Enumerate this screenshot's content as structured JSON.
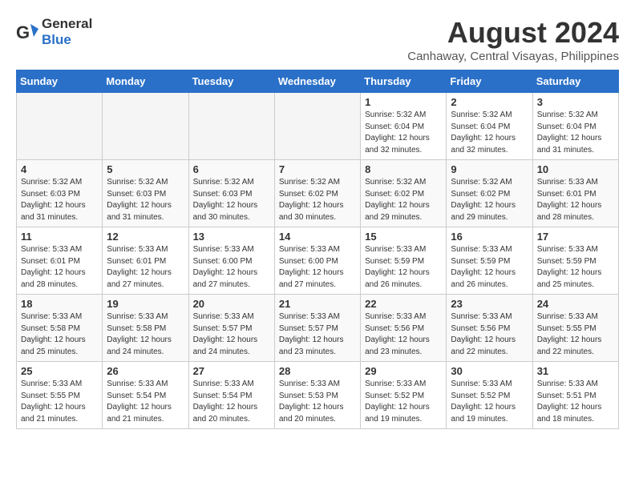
{
  "logo": {
    "general": "General",
    "blue": "Blue"
  },
  "title": {
    "month_year": "August 2024",
    "location": "Canhaway, Central Visayas, Philippines"
  },
  "headers": [
    "Sunday",
    "Monday",
    "Tuesday",
    "Wednesday",
    "Thursday",
    "Friday",
    "Saturday"
  ],
  "weeks": [
    [
      {
        "day": "",
        "info": ""
      },
      {
        "day": "",
        "info": ""
      },
      {
        "day": "",
        "info": ""
      },
      {
        "day": "",
        "info": ""
      },
      {
        "day": "1",
        "info": "Sunrise: 5:32 AM\nSunset: 6:04 PM\nDaylight: 12 hours\nand 32 minutes."
      },
      {
        "day": "2",
        "info": "Sunrise: 5:32 AM\nSunset: 6:04 PM\nDaylight: 12 hours\nand 32 minutes."
      },
      {
        "day": "3",
        "info": "Sunrise: 5:32 AM\nSunset: 6:04 PM\nDaylight: 12 hours\nand 31 minutes."
      }
    ],
    [
      {
        "day": "4",
        "info": "Sunrise: 5:32 AM\nSunset: 6:03 PM\nDaylight: 12 hours\nand 31 minutes."
      },
      {
        "day": "5",
        "info": "Sunrise: 5:32 AM\nSunset: 6:03 PM\nDaylight: 12 hours\nand 31 minutes."
      },
      {
        "day": "6",
        "info": "Sunrise: 5:32 AM\nSunset: 6:03 PM\nDaylight: 12 hours\nand 30 minutes."
      },
      {
        "day": "7",
        "info": "Sunrise: 5:32 AM\nSunset: 6:02 PM\nDaylight: 12 hours\nand 30 minutes."
      },
      {
        "day": "8",
        "info": "Sunrise: 5:32 AM\nSunset: 6:02 PM\nDaylight: 12 hours\nand 29 minutes."
      },
      {
        "day": "9",
        "info": "Sunrise: 5:32 AM\nSunset: 6:02 PM\nDaylight: 12 hours\nand 29 minutes."
      },
      {
        "day": "10",
        "info": "Sunrise: 5:33 AM\nSunset: 6:01 PM\nDaylight: 12 hours\nand 28 minutes."
      }
    ],
    [
      {
        "day": "11",
        "info": "Sunrise: 5:33 AM\nSunset: 6:01 PM\nDaylight: 12 hours\nand 28 minutes."
      },
      {
        "day": "12",
        "info": "Sunrise: 5:33 AM\nSunset: 6:01 PM\nDaylight: 12 hours\nand 27 minutes."
      },
      {
        "day": "13",
        "info": "Sunrise: 5:33 AM\nSunset: 6:00 PM\nDaylight: 12 hours\nand 27 minutes."
      },
      {
        "day": "14",
        "info": "Sunrise: 5:33 AM\nSunset: 6:00 PM\nDaylight: 12 hours\nand 27 minutes."
      },
      {
        "day": "15",
        "info": "Sunrise: 5:33 AM\nSunset: 5:59 PM\nDaylight: 12 hours\nand 26 minutes."
      },
      {
        "day": "16",
        "info": "Sunrise: 5:33 AM\nSunset: 5:59 PM\nDaylight: 12 hours\nand 26 minutes."
      },
      {
        "day": "17",
        "info": "Sunrise: 5:33 AM\nSunset: 5:59 PM\nDaylight: 12 hours\nand 25 minutes."
      }
    ],
    [
      {
        "day": "18",
        "info": "Sunrise: 5:33 AM\nSunset: 5:58 PM\nDaylight: 12 hours\nand 25 minutes."
      },
      {
        "day": "19",
        "info": "Sunrise: 5:33 AM\nSunset: 5:58 PM\nDaylight: 12 hours\nand 24 minutes."
      },
      {
        "day": "20",
        "info": "Sunrise: 5:33 AM\nSunset: 5:57 PM\nDaylight: 12 hours\nand 24 minutes."
      },
      {
        "day": "21",
        "info": "Sunrise: 5:33 AM\nSunset: 5:57 PM\nDaylight: 12 hours\nand 23 minutes."
      },
      {
        "day": "22",
        "info": "Sunrise: 5:33 AM\nSunset: 5:56 PM\nDaylight: 12 hours\nand 23 minutes."
      },
      {
        "day": "23",
        "info": "Sunrise: 5:33 AM\nSunset: 5:56 PM\nDaylight: 12 hours\nand 22 minutes."
      },
      {
        "day": "24",
        "info": "Sunrise: 5:33 AM\nSunset: 5:55 PM\nDaylight: 12 hours\nand 22 minutes."
      }
    ],
    [
      {
        "day": "25",
        "info": "Sunrise: 5:33 AM\nSunset: 5:55 PM\nDaylight: 12 hours\nand 21 minutes."
      },
      {
        "day": "26",
        "info": "Sunrise: 5:33 AM\nSunset: 5:54 PM\nDaylight: 12 hours\nand 21 minutes."
      },
      {
        "day": "27",
        "info": "Sunrise: 5:33 AM\nSunset: 5:54 PM\nDaylight: 12 hours\nand 20 minutes."
      },
      {
        "day": "28",
        "info": "Sunrise: 5:33 AM\nSunset: 5:53 PM\nDaylight: 12 hours\nand 20 minutes."
      },
      {
        "day": "29",
        "info": "Sunrise: 5:33 AM\nSunset: 5:52 PM\nDaylight: 12 hours\nand 19 minutes."
      },
      {
        "day": "30",
        "info": "Sunrise: 5:33 AM\nSunset: 5:52 PM\nDaylight: 12 hours\nand 19 minutes."
      },
      {
        "day": "31",
        "info": "Sunrise: 5:33 AM\nSunset: 5:51 PM\nDaylight: 12 hours\nand 18 minutes."
      }
    ]
  ]
}
